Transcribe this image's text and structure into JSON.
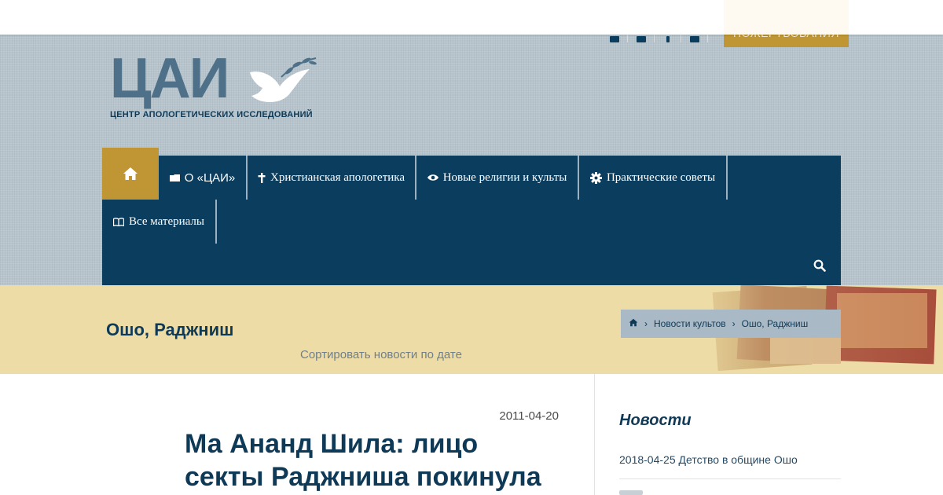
{
  "header": {
    "donate_label": "ПОЖЕРТВОВАНИЯ",
    "social_icons": [
      "vk-icon",
      "instagram-icon",
      "facebook-icon",
      "youtube-icon"
    ]
  },
  "logo": {
    "letters": "ЦАИ",
    "subtitle": "ЦЕНТР АПОЛОГЕТИЧЕСКИХ ИССЛЕДОВАНИЙ"
  },
  "nav": {
    "items": [
      {
        "label": "О «ЦАИ»",
        "icon": "folder-icon"
      },
      {
        "label": "Христианская апологетика",
        "icon": "cross-icon"
      },
      {
        "label": "Новые религии и культы",
        "icon": "eye-icon"
      },
      {
        "label": "Практические советы",
        "icon": "gear-icon"
      },
      {
        "label": "Все материалы",
        "icon": "book-icon"
      }
    ]
  },
  "page": {
    "title": "Ошо, Раджниш",
    "sort_link": "Сортировать новости по дате"
  },
  "breadcrumb": {
    "items": [
      "Новости культов",
      "Ошо, Раджниш"
    ]
  },
  "post": {
    "date": "2011-04-20",
    "title": "Ма Ананд Шила: лицо секты Раджниша покинула"
  },
  "sidebar": {
    "title": "Новости",
    "news": [
      {
        "date": "2018-04-25",
        "title": "Детство в общине Ошо"
      }
    ]
  },
  "colors": {
    "navy": "#0a3d5e",
    "gold": "#bf9633",
    "band": "#eedca6"
  }
}
